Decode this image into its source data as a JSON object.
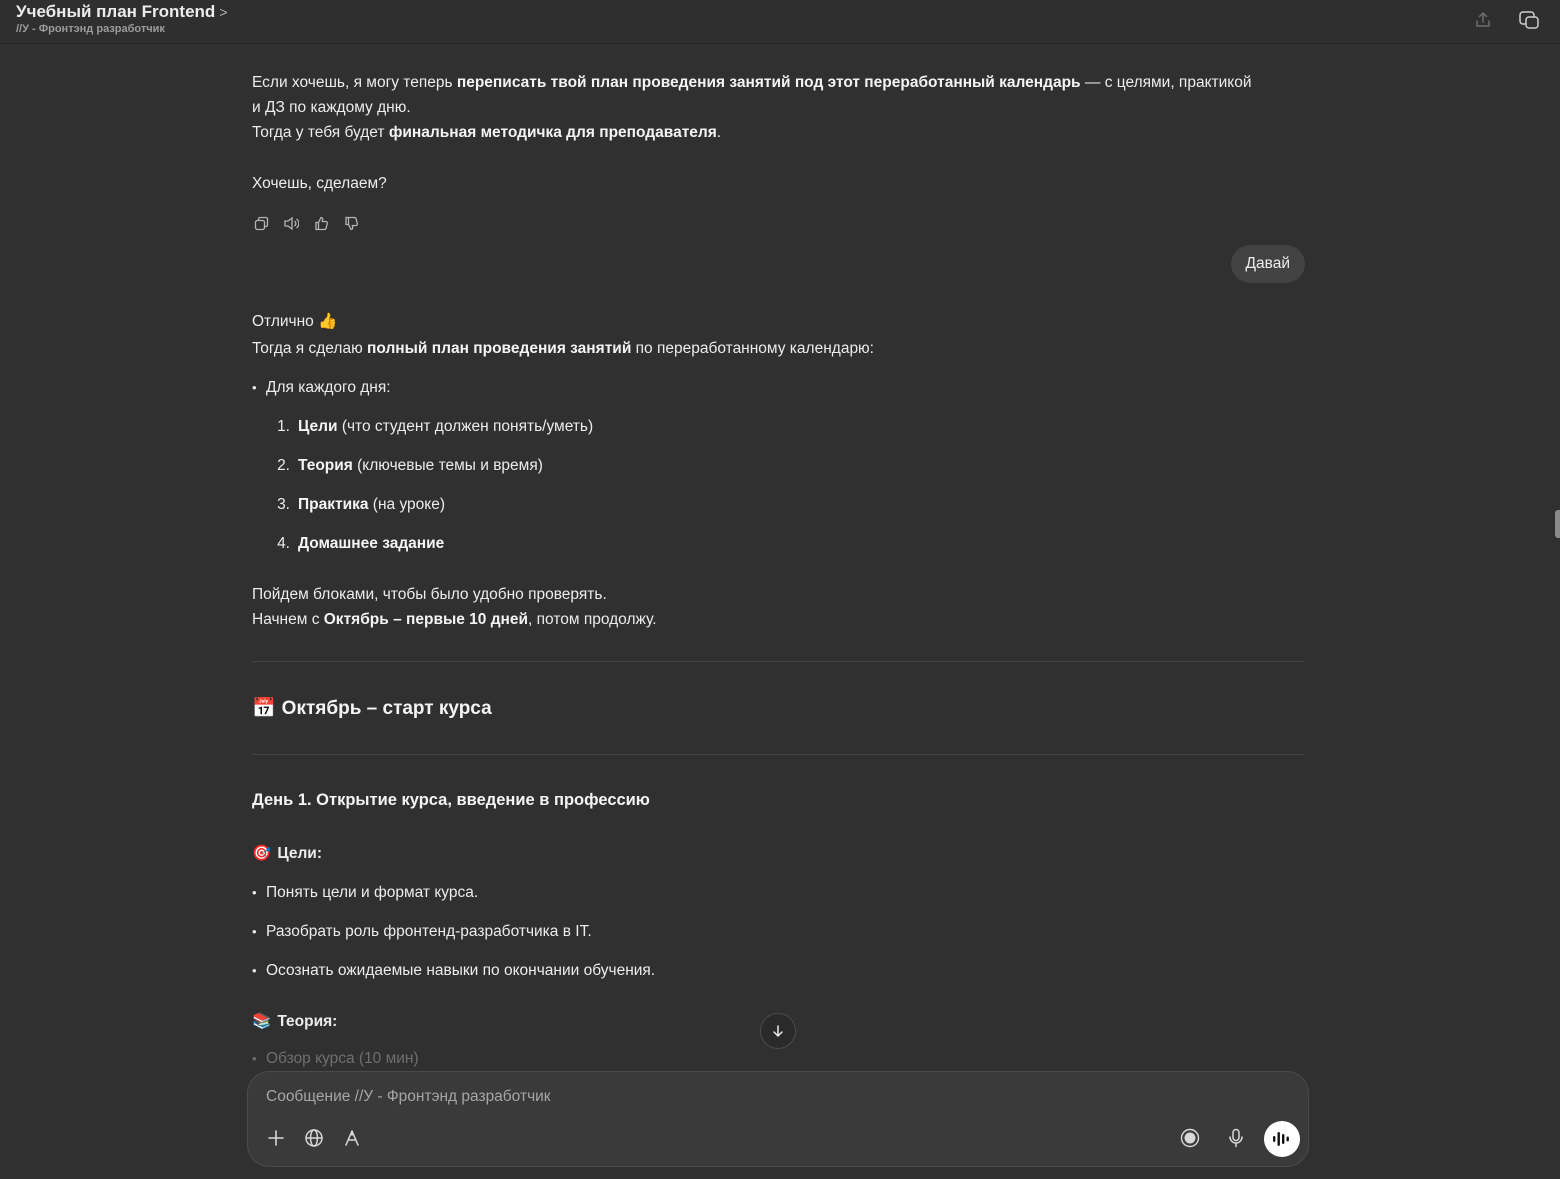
{
  "header": {
    "title": "Учебный план Frontend",
    "chevron": ">",
    "subtitle": "//У - Фронтэнд разработчик",
    "icons": [
      "share-icon",
      "new-window-icon"
    ]
  },
  "assistant1": {
    "p1_a": "Если хочешь, я могу теперь ",
    "p1_b": "переписать твой план проведения занятий под этот переработанный календарь",
    "p1_c": " — с целями, практикой",
    "p1_d": "и ДЗ по каждому дню.",
    "p2_a": "Тогда у тебя будет ",
    "p2_b": "финальная методичка для преподавателя",
    "p2_c": ".",
    "p3": "Хочешь, сделаем?",
    "action_icons": [
      "copy-icon",
      "speaker-icon",
      "thumbs-up-icon",
      "thumbs-down-icon"
    ]
  },
  "user_message": "Давай",
  "assistant2": {
    "l1_a": "Отлично ",
    "l1_emoji": "👍",
    "l2_a": "Тогда я сделаю ",
    "l2_b": "полный план проведения занятий",
    "l2_c": " по переработанному календарю:",
    "bullet": "Для каждого дня:",
    "ordered": [
      {
        "num": "1.",
        "bold": "Цели",
        "rest": " (что студент должен понять/уметь)"
      },
      {
        "num": "2.",
        "bold": "Теория",
        "rest": " (ключевые темы и время)"
      },
      {
        "num": "3.",
        "bold": "Практика",
        "rest": " (на уроке)"
      },
      {
        "num": "4.",
        "bold": "Домашнее задание",
        "rest": ""
      }
    ],
    "p_blocks": "Пойдем блоками, чтобы было удобно проверять.",
    "p_start_a": "Начнем с ",
    "p_start_b": "Октябрь – первые 10 дней",
    "p_start_c": ", потом продолжу.",
    "h2_emoji": "📅",
    "h2": "Октябрь – старт курса",
    "h3": "День 1. Открытие курса, введение в профессию",
    "goals_emoji": "🎯",
    "goals_title": "Цели:",
    "goals": [
      "Понять цели и формат курса.",
      "Разобрать роль фронтенд-разработчика в IT.",
      "Осознать ожидаемые навыки по окончании обучения."
    ],
    "theory_emoji": "📚",
    "theory_title": "Теория:",
    "theory_first": "Обзор курса (10 мин)"
  },
  "composer": {
    "placeholder": "Сообщение //У - Фронтэнд разработчик",
    "left_icons": [
      "plus-icon",
      "globe-icon",
      "tools-icon"
    ],
    "right_icons": [
      "record-icon",
      "mic-icon",
      "voice-mode-icon"
    ]
  }
}
